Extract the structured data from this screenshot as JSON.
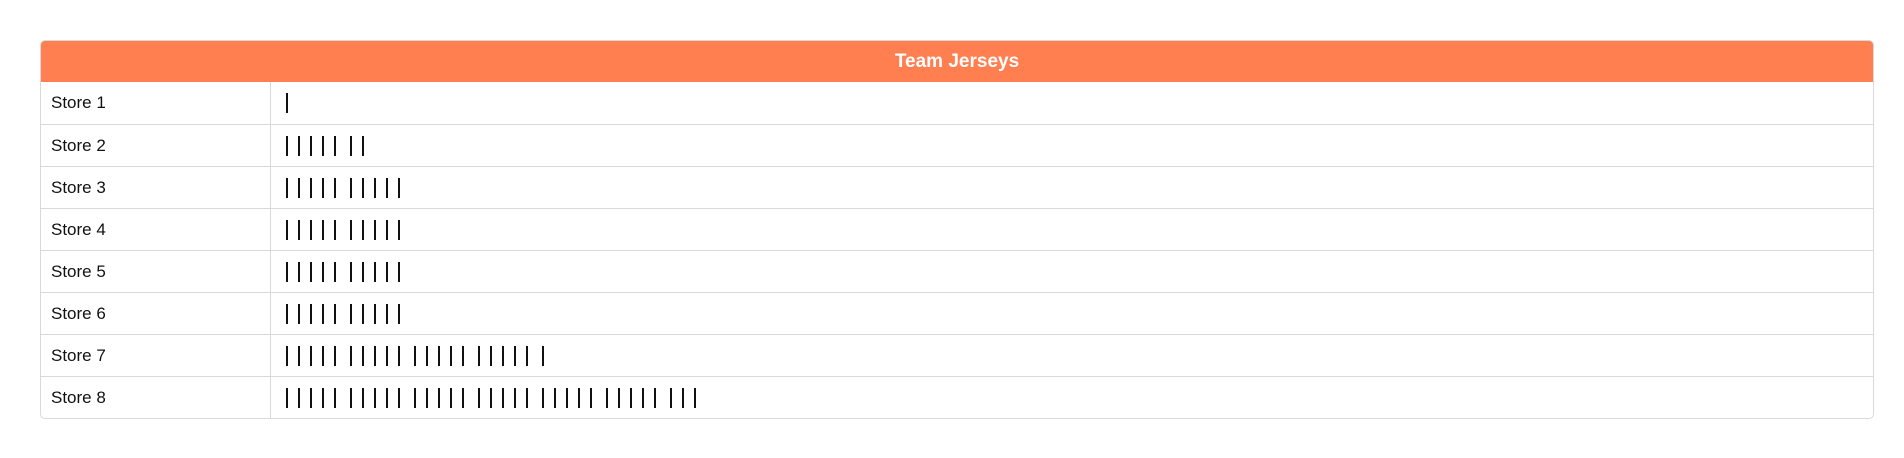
{
  "chart_data": {
    "type": "table",
    "title": "Team Jerseys",
    "categories": [
      "Store 1",
      "Store 2",
      "Store 3",
      "Store 4",
      "Store 5",
      "Store 6",
      "Store 7",
      "Store 8"
    ],
    "values": [
      1,
      7,
      10,
      10,
      10,
      10,
      21,
      33
    ],
    "encoding": "tally marks",
    "tally_group_size": 5
  },
  "colors": {
    "header_bg": "#FF7F50",
    "header_text": "#FFFFFF",
    "tally": "#111111",
    "border": "#D9D9D9"
  }
}
